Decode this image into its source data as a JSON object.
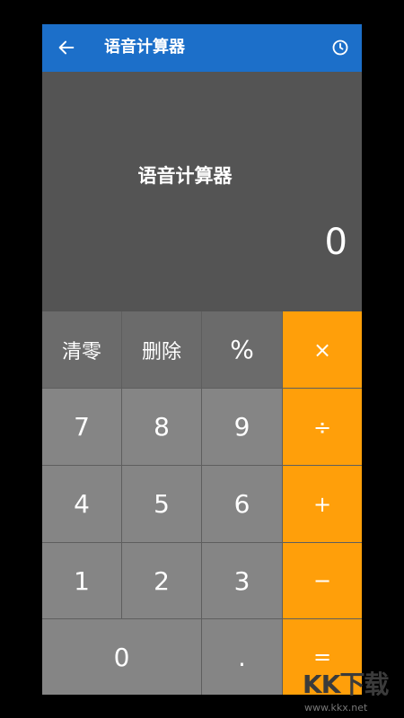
{
  "header": {
    "title": "语音计算器",
    "back_icon": "back-arrow-icon",
    "history_icon": "history-clock-icon"
  },
  "display": {
    "title": "语音计算器",
    "value": "0"
  },
  "keypad": {
    "clear": "清零",
    "delete": "删除",
    "percent": "%",
    "multiply": "×",
    "seven": "7",
    "eight": "8",
    "nine": "9",
    "divide": "÷",
    "four": "4",
    "five": "5",
    "six": "6",
    "plus": "+",
    "one": "1",
    "two": "2",
    "three": "3",
    "minus": "−",
    "zero": "0",
    "dot": ".",
    "equals": "="
  },
  "colors": {
    "header": "#1c6fc9",
    "display_bg": "#545454",
    "function_key": "#6b6b6b",
    "number_key": "#858585",
    "operator_key": "#ff9f0a"
  },
  "watermark": {
    "logo": "KK下载",
    "url": "www.kkx.net"
  }
}
